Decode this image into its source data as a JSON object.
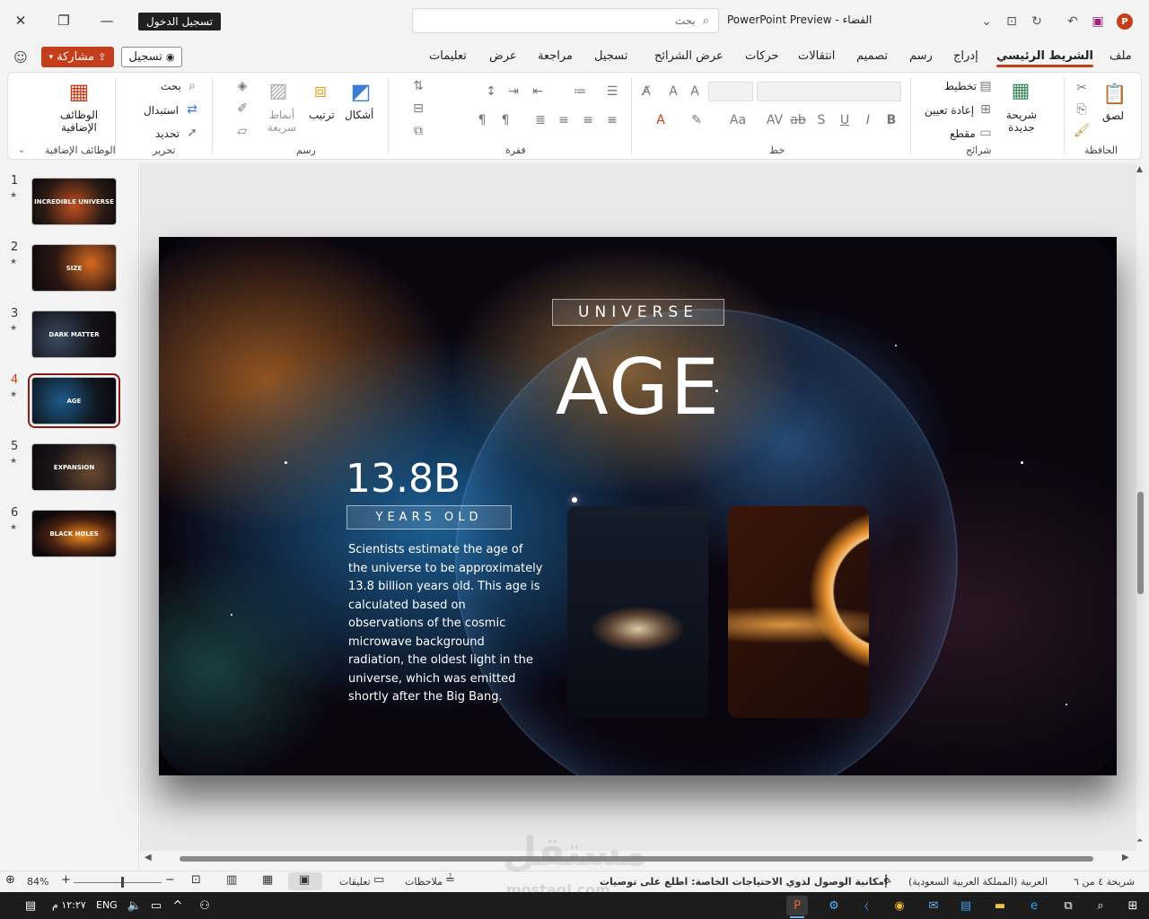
{
  "titlebar": {
    "signin_label": "تسجيل الدخول",
    "search_placeholder": "بحث",
    "doc_title": "PowerPoint Preview - الفضاء"
  },
  "tabs": {
    "file": "ملف",
    "home": "الشريط الرئيسي",
    "insert": "إدراج",
    "draw": "رسم",
    "design": "تصميم",
    "transitions": "انتقالات",
    "animations": "حركات",
    "slideshow": "عرض الشرائح",
    "record": "تسجيل",
    "review": "مراجعة",
    "view": "عرض",
    "help": "تعليمات",
    "share_label": "مشاركة",
    "record_label": "تسجيل"
  },
  "ribbon": {
    "clipboard": {
      "label": "الحافظة",
      "paste": "لصق"
    },
    "slides": {
      "label": "شرائح",
      "new_slide": "شريحة جديدة",
      "layout": "تخطيط",
      "reset": "إعادة تعيين",
      "section": "مقطع"
    },
    "font": {
      "label": "خط"
    },
    "paragraph": {
      "label": "فقرة"
    },
    "drawing": {
      "label": "رسم",
      "shapes": "أشكال",
      "arrange": "ترتيب",
      "quick_styles": "أنماط سريعة"
    },
    "editing": {
      "label": "تحرير",
      "find": "بحث",
      "replace": "استبدال",
      "select": "تحديد"
    },
    "addins": {
      "label": "الوظائف الإضافية",
      "addins_btn": "الوظائف الإضافية"
    }
  },
  "thumbnails": [
    {
      "num": "1",
      "title": "INCREDIBLE UNIVERSE"
    },
    {
      "num": "2",
      "title": "SIZE"
    },
    {
      "num": "3",
      "title": "DARK MATTER"
    },
    {
      "num": "4",
      "title": "AGE"
    },
    {
      "num": "5",
      "title": "EXPANSION"
    },
    {
      "num": "6",
      "title": "BLACK HOLES"
    }
  ],
  "slide": {
    "kicker": "UNIVERSE",
    "title": "AGE",
    "stat": "13.8B",
    "stat_label": "YEARS OLD",
    "body": "Scientists estimate the age of the universe to be approximately 13.8 billion years old. This age is calculated based on observations of the cosmic microwave background radiation, the oldest light in the universe, which was emitted shortly after the Big Bang."
  },
  "status": {
    "slide_counter": "شريحة ٤ من ٦",
    "language": "العربية (المملكة العربية السعودية)",
    "accessibility": "إمكانية الوصول لذوي الاحتياجات الخاصة: اطلع على توصيات",
    "notes": "ملاحظات",
    "comments": "تعليقات",
    "zoom": "84%"
  },
  "taskbar": {
    "time": "١٢:٢٧ م",
    "lang": "ENG"
  },
  "watermark": {
    "text": "mostaql.com"
  },
  "colors": {
    "accent": "#c43e1c",
    "selection": "#8b1a1a"
  }
}
